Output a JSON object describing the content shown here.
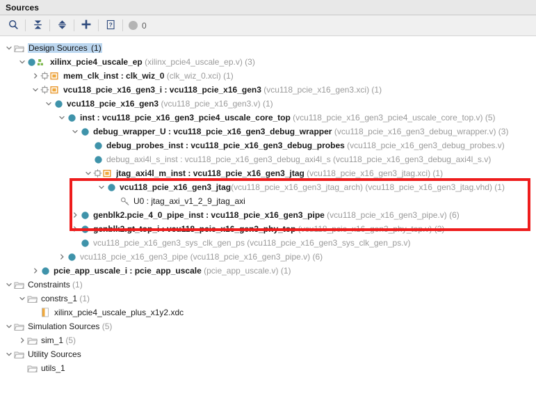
{
  "window": {
    "title": "Sources"
  },
  "toolbar": {
    "search_label": "Search",
    "collapse_all_label": "Collapse All",
    "expand_all_label": "Expand All",
    "add_sources_label": "Add Sources",
    "help_label": "Help",
    "count": "0"
  },
  "annotation": {
    "highlight_color": "#ee1c1c"
  },
  "tree": [
    {
      "indent": 0,
      "twisty": "down",
      "icon": "folder",
      "name": "Design Sources",
      "suffix": " (1)",
      "selected": true
    },
    {
      "indent": 1,
      "twisty": "down",
      "icon": "module-hier",
      "name": "xilinx_pcie4_uscale_ep",
      "bold": true,
      "file": " (xilinx_pcie4_uscale_ep.v)",
      "suffix": " (3)"
    },
    {
      "indent": 2,
      "twisty": "right",
      "icon": "ip",
      "name": "mem_clk_inst : clk_wiz_0",
      "bold": true,
      "file": " (clk_wiz_0.xci)",
      "suffix": " (1)"
    },
    {
      "indent": 2,
      "twisty": "down",
      "icon": "ip",
      "name": "vcu118_pcie_x16_gen3_i : vcu118_pcie_x16_gen3",
      "bold": true,
      "file": " (vcu118_pcie_x16_gen3.xci)",
      "suffix": " (1)"
    },
    {
      "indent": 3,
      "twisty": "down",
      "icon": "module",
      "name": "vcu118_pcie_x16_gen3",
      "bold": true,
      "file": " (vcu118_pcie_x16_gen3.v)",
      "suffix": " (1)"
    },
    {
      "indent": 4,
      "twisty": "down",
      "icon": "module",
      "name": "inst : vcu118_pcie_x16_gen3_pcie4_uscale_core_top",
      "bold": true,
      "file": " (vcu118_pcie_x16_gen3_pcie4_uscale_core_top.v)",
      "suffix": " (5)"
    },
    {
      "indent": 5,
      "twisty": "down",
      "icon": "module",
      "name": "debug_wrapper_U : vcu118_pcie_x16_gen3_debug_wrapper",
      "bold": true,
      "file": " (vcu118_pcie_x16_gen3_debug_wrapper.v)",
      "suffix": " (3)"
    },
    {
      "indent": 6,
      "twisty": "none",
      "icon": "module",
      "name": "debug_probes_inst : vcu118_pcie_x16_gen3_debug_probes",
      "bold": true,
      "file": " (vcu118_pcie_x16_gen3_debug_probes.v)",
      "suffix": ""
    },
    {
      "indent": 6,
      "twisty": "none",
      "icon": "module",
      "name": "debug_axi4l_s_inst : vcu118_pcie_x16_gen3_debug_axi4l_s",
      "dimmed": true,
      "file": " (vcu118_pcie_x16_gen3_debug_axi4l_s.v)",
      "suffix": ""
    },
    {
      "indent": 6,
      "twisty": "down",
      "icon": "ip",
      "name": "jtag_axi4l_m_inst : vcu118_pcie_x16_gen3_jtag",
      "bold": true,
      "file": " (vcu118_pcie_x16_gen3_jtag.xci)",
      "suffix": " (1)"
    },
    {
      "indent": 7,
      "twisty": "down",
      "icon": "module",
      "name": "vcu118_pcie_x16_gen3_jtag",
      "bold": true,
      "file": "(vcu118_pcie_x16_gen3_jtag_arch) (vcu118_pcie_x16_gen3_jtag.vhd)",
      "suffix": " (1)"
    },
    {
      "indent": 8,
      "twisty": "none",
      "icon": "key",
      "name": "U0 : jtag_axi_v1_2_9_jtag_axi",
      "file": "",
      "suffix": ""
    },
    {
      "indent": 5,
      "twisty": "right",
      "icon": "module",
      "name": "genblk2.pcie_4_0_pipe_inst : vcu118_pcie_x16_gen3_pipe",
      "bold": true,
      "file": " (vcu118_pcie_x16_gen3_pipe.v)",
      "suffix": " (6)"
    },
    {
      "indent": 5,
      "twisty": "right",
      "icon": "module",
      "name": "genblk2.gt_top_i : vcu118_pcie_x16_gen3_phy_top",
      "bold": true,
      "file": " (vcu118_pcie_x16_gen3_phy_top.v)",
      "suffix": " (2)"
    },
    {
      "indent": 5,
      "twisty": "none",
      "icon": "module",
      "name": "vcu118_pcie_x16_gen3_sys_clk_gen_ps",
      "dimmed": true,
      "file": " (vcu118_pcie_x16_gen3_sys_clk_gen_ps.v)",
      "suffix": ""
    },
    {
      "indent": 4,
      "twisty": "right",
      "icon": "module",
      "name": "vcu118_pcie_x16_gen3_pipe",
      "dimmed": true,
      "file": " (vcu118_pcie_x16_gen3_pipe.v)",
      "suffix": " (6)"
    },
    {
      "indent": 2,
      "twisty": "right",
      "icon": "module",
      "name": "pcie_app_uscale_i : pcie_app_uscale",
      "bold": true,
      "file": " (pcie_app_uscale.v)",
      "suffix": " (1)"
    },
    {
      "indent": 0,
      "twisty": "down",
      "icon": "folder",
      "name": "Constraints",
      "suffix": " (1)"
    },
    {
      "indent": 1,
      "twisty": "down",
      "icon": "folder",
      "name": "constrs_1",
      "suffix": " (1)"
    },
    {
      "indent": 2,
      "twisty": "none",
      "icon": "xdc-file",
      "name": "xilinx_pcie4_uscale_plus_x1y2.xdc",
      "suffix": ""
    },
    {
      "indent": 0,
      "twisty": "down",
      "icon": "folder",
      "name": "Simulation Sources",
      "suffix": " (5)"
    },
    {
      "indent": 1,
      "twisty": "right",
      "icon": "folder",
      "name": "sim_1",
      "suffix": " (5)"
    },
    {
      "indent": 0,
      "twisty": "down",
      "icon": "folder",
      "name": "Utility Sources",
      "suffix": ""
    },
    {
      "indent": 1,
      "twisty": "none",
      "icon": "folder",
      "name": "utils_1",
      "suffix": ""
    }
  ]
}
